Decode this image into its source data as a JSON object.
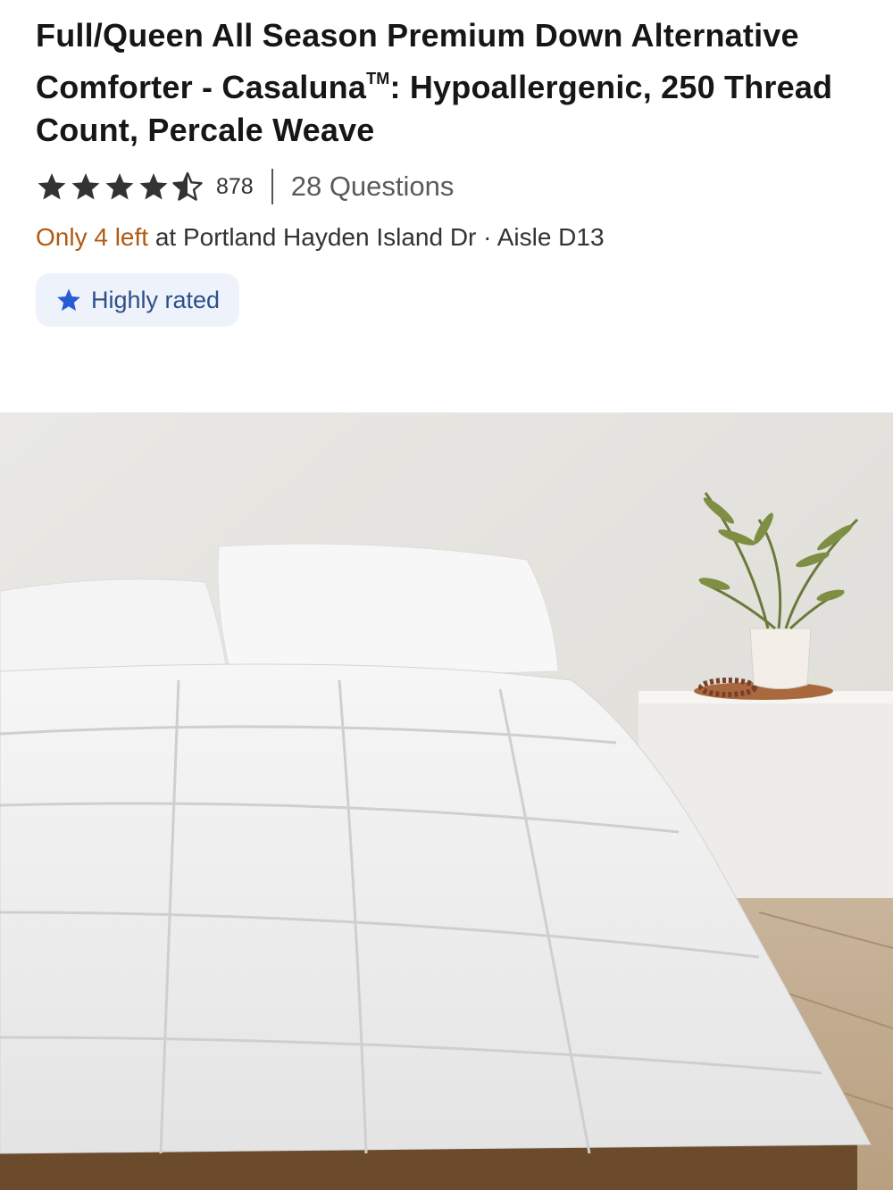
{
  "product": {
    "title": "Full/Queen All Season Premium Down Alternative Comforter - Casaluna",
    "title_tm": "TM",
    "title_suffix": ": Hypoallergenic, 250 Thread Count, Percale Weave",
    "rating": 4.5,
    "review_count": "878",
    "questions": "28 Questions"
  },
  "stock": {
    "only_left": "Only 4 left",
    "location": " at Portland Hayden Island Dr · Aisle D13"
  },
  "badge": {
    "label": "Highly rated",
    "icon": "star-icon",
    "color": "#2a5bd7"
  },
  "image": {
    "subject": "product-photo"
  },
  "colors": {
    "star": "#333333",
    "stock_accent": "#b25a10",
    "badge_bg": "#eef3fb"
  }
}
